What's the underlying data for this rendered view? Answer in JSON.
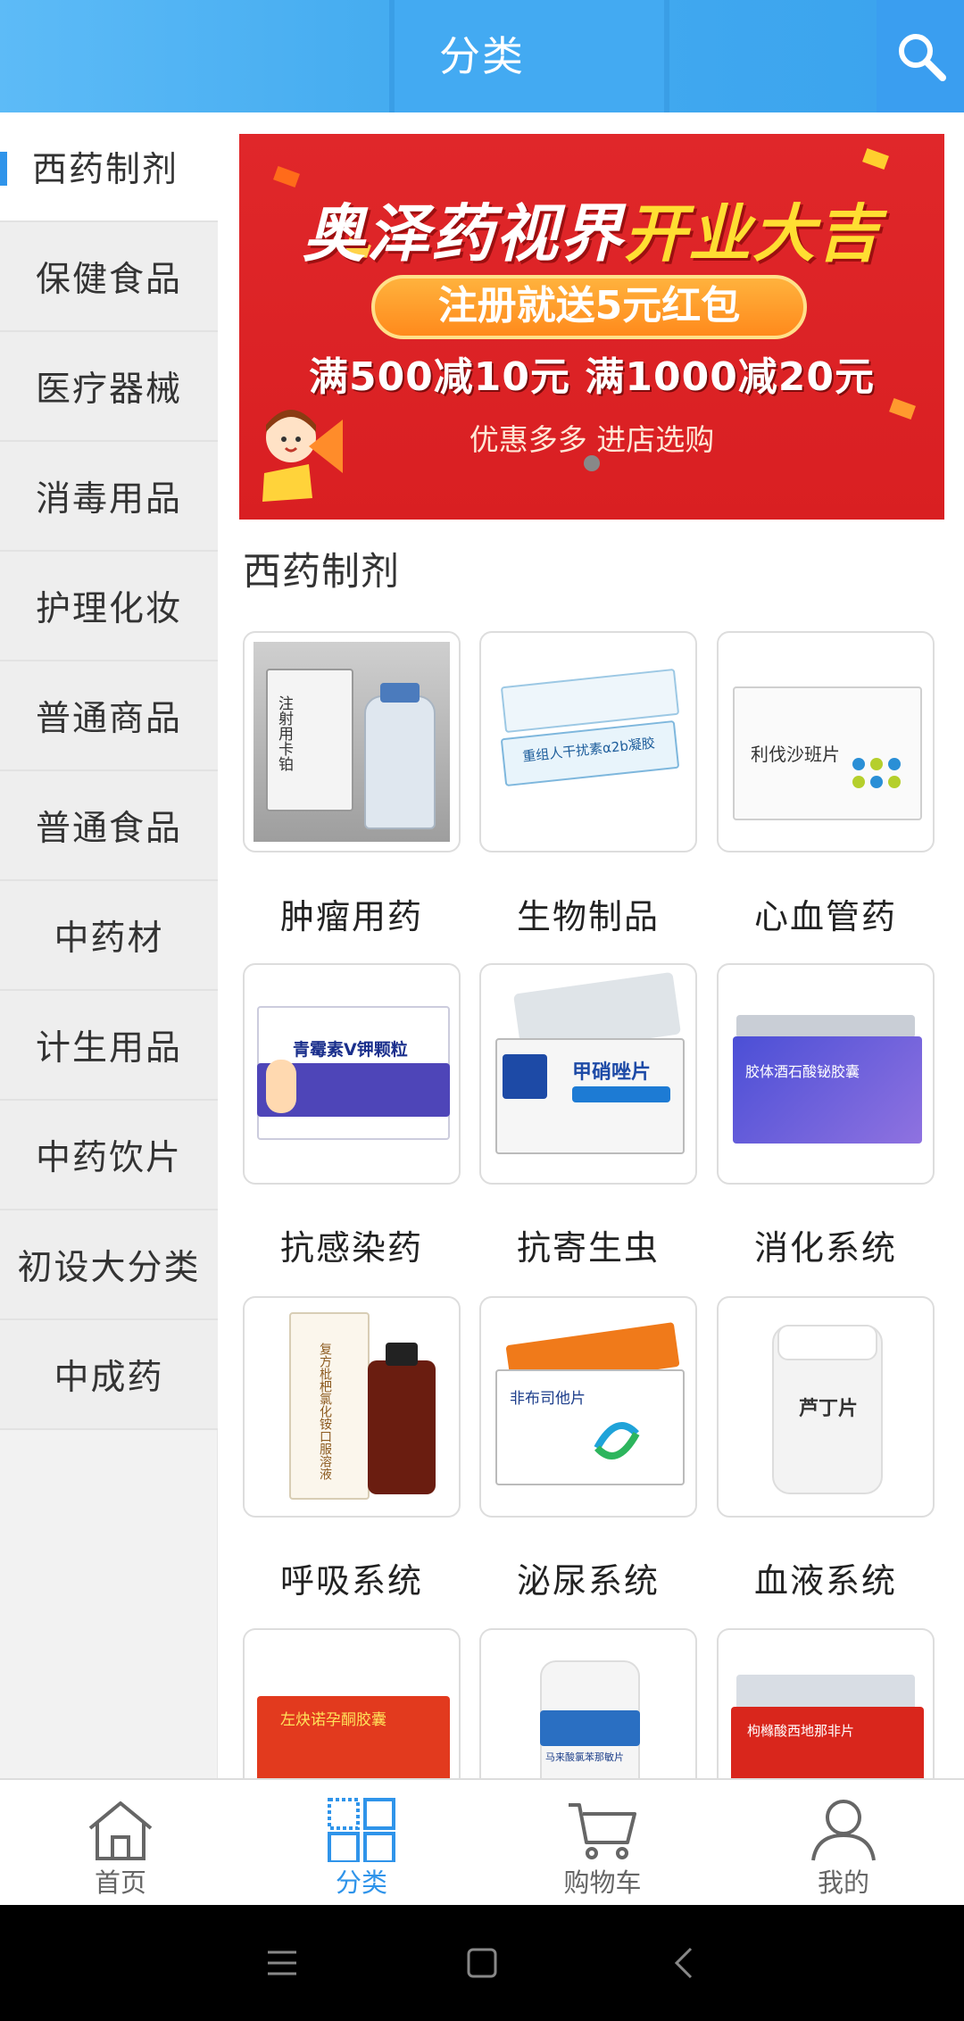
{
  "header": {
    "title": "分类",
    "search_icon": "search-icon"
  },
  "sidebar": {
    "items": [
      {
        "label": "西药制剂",
        "active": true
      },
      {
        "label": "保健食品"
      },
      {
        "label": "医疗器械"
      },
      {
        "label": "消毒用品"
      },
      {
        "label": "护理化妆"
      },
      {
        "label": "普通商品"
      },
      {
        "label": "普通食品"
      },
      {
        "label": "中药材"
      },
      {
        "label": "计生用品"
      },
      {
        "label": "中药饮片"
      },
      {
        "label": "初设大分类"
      },
      {
        "label": "中成药"
      }
    ]
  },
  "banner": {
    "line1_white": "奥泽药视界",
    "line1_yellow": "开业大吉",
    "pill": "注册就送5元红包",
    "line3": "满500减10元 满1000减20元",
    "line4": "优惠多多 进店选购"
  },
  "section": {
    "title": "西药制剂"
  },
  "products": [
    {
      "label": "肿瘤用药",
      "box_text": "注射用卡铂"
    },
    {
      "label": "生物制品",
      "box_text": "重组人干扰素α2b凝胶"
    },
    {
      "label": "心血管药",
      "box_text": "利伐沙班片"
    },
    {
      "label": "抗感染药",
      "box_text": "青霉素V钾颗粒"
    },
    {
      "label": "抗寄生虫",
      "box_text": "甲硝唑片"
    },
    {
      "label": "消化系统",
      "box_text": "胶体酒石酸铋胶囊"
    },
    {
      "label": "呼吸系统",
      "box_text": "复方枇杷氯化铵口服溶液"
    },
    {
      "label": "泌尿系统",
      "box_text": "非布司他片"
    },
    {
      "label": "血液系统",
      "box_text": "芦丁片"
    },
    {
      "label": "",
      "box_text": "左炔诺孕酮胶囊"
    },
    {
      "label": "",
      "box_text": "马来酸氯苯那敏片"
    },
    {
      "label": "",
      "box_text": "枸橼酸西地那非片"
    }
  ],
  "tabbar": {
    "tabs": [
      {
        "label": "首页",
        "icon": "home-icon"
      },
      {
        "label": "分类",
        "icon": "grid-icon",
        "active": true
      },
      {
        "label": "购物车",
        "icon": "cart-icon"
      },
      {
        "label": "我的",
        "icon": "user-icon"
      }
    ]
  },
  "colors": {
    "accent": "#2f94ea",
    "header": "#45acf0",
    "banner_red": "#e0272a"
  }
}
